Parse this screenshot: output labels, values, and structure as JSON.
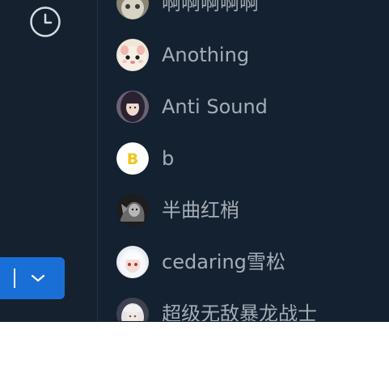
{
  "sidebar": {
    "history_icon": "clock-icon",
    "split_button": {
      "chevron_icon": "chevron-down-icon"
    }
  },
  "contacts": {
    "items": [
      {
        "name": "啊啊啊啊啊",
        "avatar": "avatar-cat-partial"
      },
      {
        "name": "Anothing",
        "avatar": "avatar-hamster"
      },
      {
        "name": "Anti Sound",
        "avatar": "avatar-dark-hair-girl"
      },
      {
        "name": "b",
        "avatar": "avatar-letter-b",
        "avatar_letter": "B"
      },
      {
        "name": "半曲红梢",
        "avatar": "avatar-monochrome-sketch"
      },
      {
        "name": "cedaring雪松",
        "avatar": "avatar-white-hair-anime"
      },
      {
        "name": "超级无敌暴龙战士",
        "avatar": "avatar-light-anime"
      }
    ]
  },
  "colors": {
    "background": "#142030",
    "accent": "#1a6fd6",
    "text_secondary": "#a6adb6",
    "letter_avatar_bg": "#ffffff",
    "letter_avatar_fg": "#f0c419"
  }
}
